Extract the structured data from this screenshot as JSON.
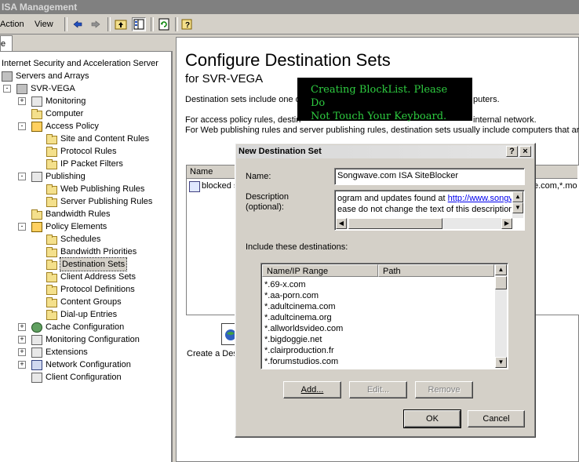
{
  "window": {
    "title": "ISA Management"
  },
  "menu": {
    "action": "Action",
    "view": "View"
  },
  "tree_tab_label": "e",
  "tree": [
    {
      "label": "Internet Security and Acceleration Server",
      "level": 0,
      "icon": "server-icon"
    },
    {
      "label": "Servers and Arrays",
      "level": 1,
      "icon": "servers-icon"
    },
    {
      "label": "SVR-VEGA",
      "level": 2,
      "icon": "server-icon",
      "exp": "-"
    },
    {
      "label": "Monitoring",
      "level": 3,
      "icon": "monitoring-icon",
      "exp": "+"
    },
    {
      "label": "Computer",
      "level": 3,
      "icon": "folder-icon"
    },
    {
      "label": "Access Policy",
      "level": 3,
      "icon": "access-policy-icon",
      "exp": "-"
    },
    {
      "label": "Site and Content Rules",
      "level": 4,
      "icon": "folder-icon"
    },
    {
      "label": "Protocol Rules",
      "level": 4,
      "icon": "folder-icon"
    },
    {
      "label": "IP Packet Filters",
      "level": 4,
      "icon": "folder-icon"
    },
    {
      "label": "Publishing",
      "level": 3,
      "icon": "publishing-icon",
      "exp": "-"
    },
    {
      "label": "Web Publishing Rules",
      "level": 4,
      "icon": "folder-icon"
    },
    {
      "label": "Server Publishing Rules",
      "level": 4,
      "icon": "folder-icon"
    },
    {
      "label": "Bandwidth Rules",
      "level": 3,
      "icon": "folder-icon"
    },
    {
      "label": "Policy Elements",
      "level": 3,
      "icon": "policy-elements-icon",
      "exp": "-"
    },
    {
      "label": "Schedules",
      "level": 4,
      "icon": "folder-icon"
    },
    {
      "label": "Bandwidth Priorities",
      "level": 4,
      "icon": "folder-icon"
    },
    {
      "label": "Destination Sets",
      "level": 4,
      "icon": "folder-icon",
      "selected": true
    },
    {
      "label": "Client Address Sets",
      "level": 4,
      "icon": "folder-icon"
    },
    {
      "label": "Protocol Definitions",
      "level": 4,
      "icon": "folder-icon"
    },
    {
      "label": "Content Groups",
      "level": 4,
      "icon": "folder-icon"
    },
    {
      "label": "Dial-up Entries",
      "level": 4,
      "icon": "folder-icon"
    },
    {
      "label": "Cache Configuration",
      "level": 3,
      "icon": "cache-icon",
      "exp": "+"
    },
    {
      "label": "Monitoring Configuration",
      "level": 3,
      "icon": "monitoring-config-icon",
      "exp": "+"
    },
    {
      "label": "Extensions",
      "level": 3,
      "icon": "extensions-icon",
      "exp": "+"
    },
    {
      "label": "Network Configuration",
      "level": 3,
      "icon": "network-icon",
      "exp": "+"
    },
    {
      "label": "Client Configuration",
      "level": 3,
      "icon": "client-config-icon"
    }
  ],
  "main": {
    "title": "Configure Destination Sets",
    "subtitle": "for SVR-VEGA",
    "desc_line1_start": "Destination sets include one o",
    "desc_line1_end": "puters.",
    "desc_line2_start": "For access policy rules, destin",
    "desc_line2_end": "internal network.",
    "desc_line3": "For Web publishing rules and server publishing rules, destination sets usually include computers that are in y",
    "list_col_name": "Name",
    "list_row_name": "blocked s",
    "list_row_end": "e.com,*.mo",
    "create_label": "Create a Des"
  },
  "overlay": {
    "line1": "Creating BlockList.  Please Do",
    "line2": "Not Touch Your Keyboard."
  },
  "dialog": {
    "title": "New Destination Set",
    "help_btn": "?",
    "close_btn": "×",
    "name_label": "Name:",
    "name_value": "Songwave.com ISA SiteBlocker",
    "desc_label_1": "Description",
    "desc_label_2": "(optional):",
    "desc_line1_text": "ogram and updates found at ",
    "desc_line1_link": "http://www.songv",
    "desc_line2_text": "ease do not change the text of this description.",
    "include_label": "Include these destinations:",
    "col_name": "Name/IP Range",
    "col_path": "Path",
    "destinations": [
      "*.69-x.com",
      "*.aa-porn.com",
      "*.adultcinema.com",
      "*.adultcinema.org",
      "*.allworldsvideo.com",
      "*.bigdoggie.net",
      "*.clairproduction.fr",
      "*.forumstudios.com"
    ],
    "add_btn": "Add...",
    "edit_btn": "Edit...",
    "remove_btn": "Remove",
    "ok_btn": "OK",
    "cancel_btn": "Cancel"
  }
}
